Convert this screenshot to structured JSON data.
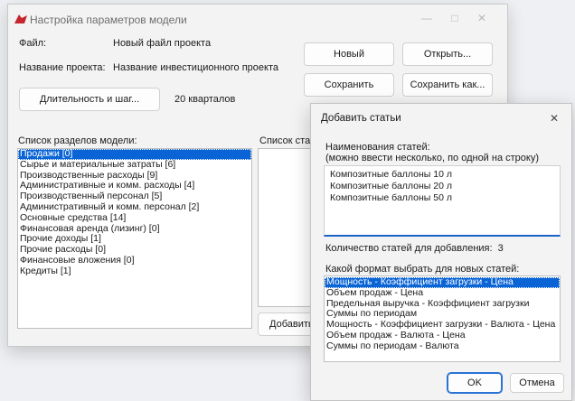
{
  "main": {
    "title": "Настройка параметров модели",
    "file_label": "Файл:",
    "file_value": "Новый файл проекта",
    "project_label": "Название проекта:",
    "project_value": "Название инвестиционного проекта",
    "duration_button": "Длительность и шаг...",
    "duration_value": "20 кварталов",
    "buttons": {
      "new": "Новый",
      "open": "Открыть...",
      "save": "Сохранить",
      "save_as": "Сохранить как..."
    },
    "sections_label": "Список разделов модели:",
    "sections": [
      "Продажи [0]",
      "Сырье и материальные затраты [6]",
      "Производственные расходы [9]",
      "Административные и комм. расходы [4]",
      "Производственный персонал [5]",
      "Административный и комм. персонал [2]",
      "Основные средства [14]",
      "Финансовая аренда (лизинг) [0]",
      "Прочие доходы [1]",
      "Прочие расходы [0]",
      "Финансовые вложения [0]",
      "Кредиты [1]"
    ],
    "articles_label": "Список стате",
    "add_button": "Добавить..."
  },
  "dialog": {
    "title": "Добавить статьи",
    "names_label_1": "Наименования статей:",
    "names_label_2": "(можно ввести несколько, по одной на строку)",
    "names": [
      "Композитные баллоны 10 л",
      "Композитные баллоны 20 л",
      "Композитные баллоны 50 л"
    ],
    "count_label": "Количество статей для добавления:",
    "count_value": "3",
    "format_label": "Какой формат выбрать для новых статей:",
    "formats": [
      "Мощность - Коэффициент загрузки - Цена",
      "Объем продаж - Цена",
      "Предельная выручка - Коэффициент загрузки",
      "Суммы по периодам",
      "Мощность - Коэффициент загрузки - Валюта - Цена",
      "Объем продаж - Валюта - Цена",
      "Суммы по периодам - Валюта"
    ],
    "ok": "OK",
    "cancel": "Отмена"
  },
  "icons": {
    "app": "app-logo-icon",
    "minimize": "minimize-icon",
    "maximize": "maximize-icon",
    "close": "close-icon"
  },
  "colors": {
    "selection": "#0a64d6",
    "accent": "#1a64c8",
    "logo": "#c6262e"
  }
}
